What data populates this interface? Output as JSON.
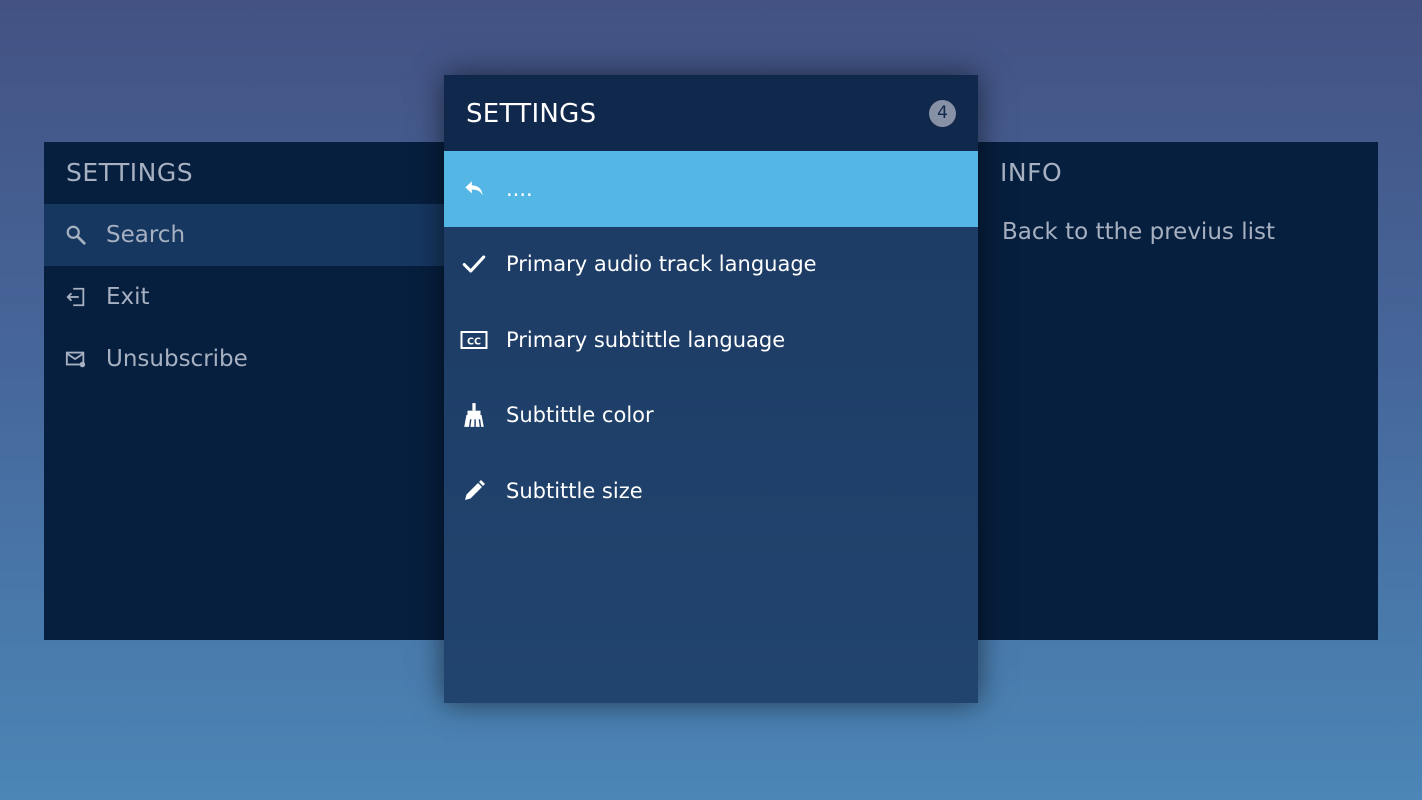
{
  "left_panel": {
    "title": "SETTINGS",
    "items": [
      {
        "label": "Search",
        "icon": "search-icon"
      },
      {
        "label": "Exit",
        "icon": "exit-icon"
      },
      {
        "label": "Unsubscribe",
        "icon": "mail-icon"
      }
    ]
  },
  "center_panel": {
    "title": "SETTINGS",
    "badge": "4",
    "items": [
      {
        "label": "....",
        "icon": "back-arrow-icon"
      },
      {
        "label": "Primary audio track language",
        "icon": "check-icon"
      },
      {
        "label": "Primary subtittle language",
        "icon": "closed-caption-icon"
      },
      {
        "label": "Subtittle color",
        "icon": "paint-brush-icon"
      },
      {
        "label": "Subtittle size",
        "icon": "pencil-icon"
      }
    ]
  },
  "right_panel": {
    "title": "INFO",
    "text": "Back to tthe previus list"
  },
  "colors": {
    "selection": "#54b6e4",
    "panel_dark": "#061f3e",
    "header_dark": "#11284d"
  }
}
